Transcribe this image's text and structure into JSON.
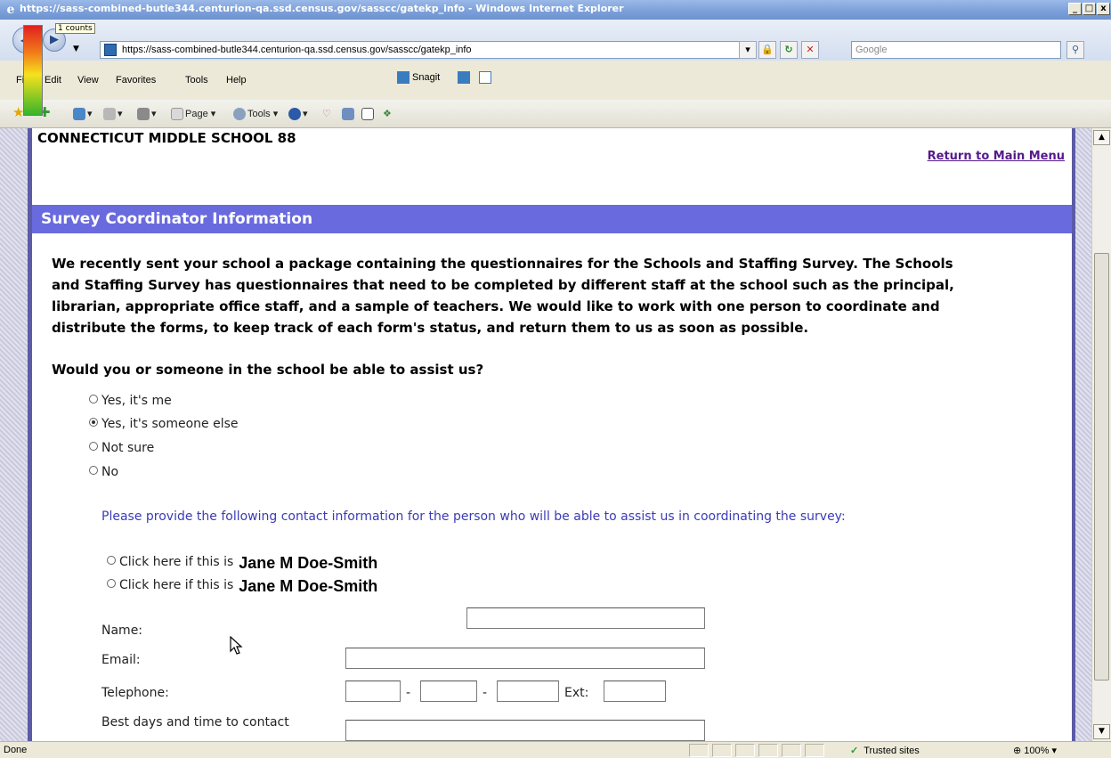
{
  "window": {
    "title": "https://sass-combined-butle344.centurion-qa.ssd.census.gov/sasscc/gatekp_info - Windows Internet Explorer",
    "minimize": "_",
    "maximize": "□",
    "close": "x"
  },
  "badge": {
    "text": "1 counts"
  },
  "address": {
    "url": "https://sass-combined-butle344.centurion-qa.ssd.census.gov/sasscc/gatekp_info",
    "search_placeholder": "Google"
  },
  "menu": {
    "items": [
      "File",
      "Edit",
      "View",
      "Favorites",
      "Tools",
      "Help"
    ],
    "snagit": "Snagit"
  },
  "commandbar": {
    "page": "Page",
    "tools": "Tools"
  },
  "page": {
    "school_name": "CONNECTICUT MIDDLE SCHOOL 88",
    "return_link": "Return to Main Menu",
    "section_title": "Survey Coordinator Information",
    "intro_line1": "We recently sent your school a package containing the questionnaires for the Schools and Staffing Survey. The Schools",
    "intro_line2": "and Staffing Survey has questionnaires that need to be completed by different staff at the school such as the principal,",
    "intro_line3": "librarian, appropriate office staff, and a sample of teachers. We would like to work with one person to coordinate and",
    "intro_line4": "distribute the forms, to keep track of each form's status, and return them to us as soon as possible.",
    "question": "Would you or someone in the school be able to assist us?",
    "options": [
      {
        "label": "Yes, it's me",
        "selected": false
      },
      {
        "label": "Yes, it's someone else",
        "selected": true
      },
      {
        "label": "Not sure",
        "selected": false
      },
      {
        "label": "No",
        "selected": false
      }
    ],
    "contact_prompt": "Please provide the following contact information for the person who will be able to assist us in coordinating the survey:",
    "click_label": "Click here if this is",
    "click_names": [
      "Jane M Doe-Smith",
      "Jane M Doe-Smith"
    ],
    "form": {
      "name_label": "Name:",
      "email_label": "Email:",
      "phone_label": "Telephone:",
      "ext_label": "Ext:",
      "phone_sep": "-",
      "best_label": "Best days and time to contact"
    }
  },
  "status": {
    "text": "Done",
    "zone": "Trusted sites",
    "zoom": "100%"
  }
}
